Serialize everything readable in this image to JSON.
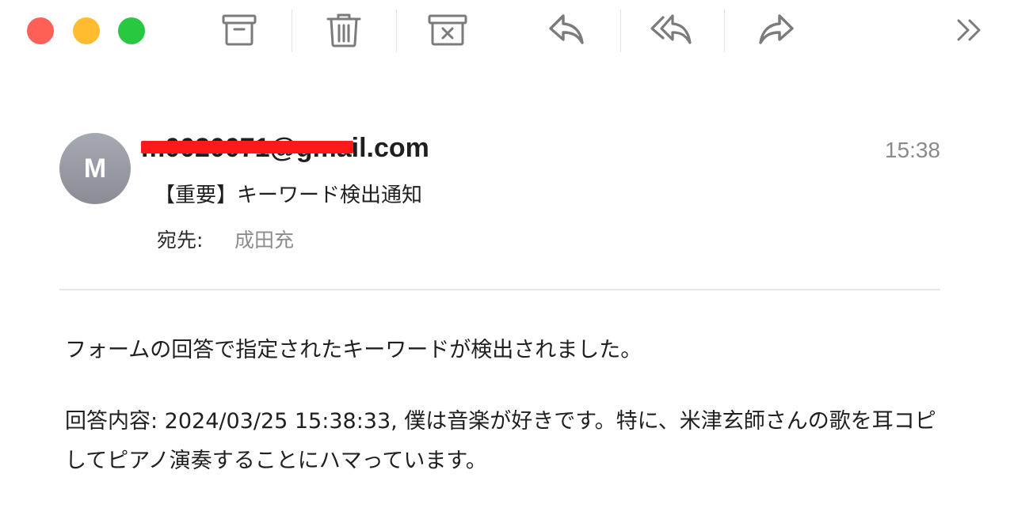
{
  "window": {
    "controls": [
      "close",
      "minimize",
      "zoom"
    ]
  },
  "toolbar": {
    "buttons": [
      {
        "name": "archive",
        "icon": "archive-icon"
      },
      {
        "name": "trash",
        "icon": "trash-icon"
      },
      {
        "name": "junk",
        "icon": "junk-icon"
      },
      {
        "name": "reply",
        "icon": "reply-icon"
      },
      {
        "name": "reply-all",
        "icon": "reply-all-icon"
      },
      {
        "name": "forward",
        "icon": "forward-icon"
      },
      {
        "name": "more",
        "icon": "chevron-double-right-icon"
      }
    ]
  },
  "message": {
    "avatar_initial": "M",
    "sender": "m0020071@gmail.com",
    "time": "15:38",
    "subject": "【重要】キーワード検出通知",
    "to_label": "宛先:",
    "to_value": "成田充",
    "body": {
      "line1": "フォームの回答で指定されたキーワードが検出されました。",
      "line2": "回答内容: 2024/03/25 15:38:33, 僕は音楽が好きです。特に、米津玄師さんの歌を耳コピしてピアノ演奏することにハマっています。"
    }
  },
  "colors": {
    "close": "#fe5f57",
    "minimize": "#febc2e",
    "zoom": "#28c840",
    "redaction": "#ff1a1a"
  }
}
